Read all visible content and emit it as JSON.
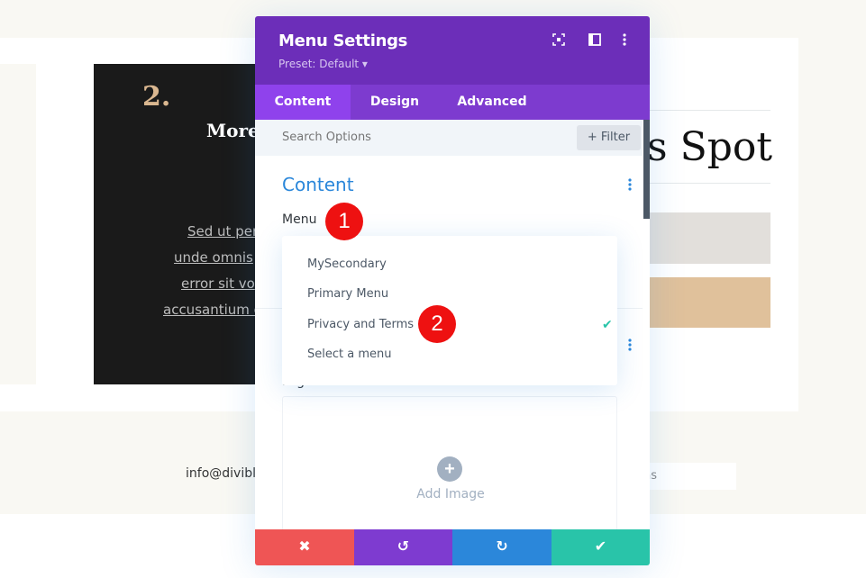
{
  "background": {
    "dark_card": {
      "number": "2.",
      "title": "More",
      "lines": [
        "Sed ut per",
        "unde omnis",
        "error sit vo",
        "accusantium d"
      ]
    },
    "heading_fragment": "s Spot",
    "footer_email": "info@divibl",
    "footer_input_fragment": "ns"
  },
  "modal": {
    "title": "Menu Settings",
    "preset": "Preset: Default ▾",
    "header_icons": [
      "focus-icon",
      "sidebar-toggle-icon",
      "more-options-icon"
    ],
    "tabs": [
      {
        "label": "Content",
        "active": true
      },
      {
        "label": "Design",
        "active": false
      },
      {
        "label": "Advanced",
        "active": false
      }
    ],
    "search": {
      "placeholder": "Search Options"
    },
    "filter_label": "+ Filter",
    "section_title": "Content",
    "menu_label": "Menu",
    "logo_label": "Logo",
    "add_image_label": "Add Image",
    "dropdown": {
      "items": [
        {
          "label": "MySecondary",
          "selected": false
        },
        {
          "label": "Primary Menu",
          "selected": false
        },
        {
          "label": "Privacy and Terms",
          "selected": true
        },
        {
          "label": "Select a menu",
          "selected": false
        }
      ]
    },
    "footer_buttons": [
      {
        "name": "discard",
        "icon": "✖",
        "color": "#ef5555"
      },
      {
        "name": "undo",
        "icon": "↺",
        "color": "#7e3bd0"
      },
      {
        "name": "redo",
        "icon": "↻",
        "color": "#2b87da"
      },
      {
        "name": "save",
        "icon": "✔",
        "color": "#29c4a9"
      }
    ]
  },
  "annotations": [
    {
      "label": "1"
    },
    {
      "label": "2"
    }
  ],
  "colors": {
    "header": "#6c2eb9",
    "tabs": "#7d3bcf",
    "active_tab": "#8f42ec",
    "accent_blue": "#2b87da",
    "check_green": "#29c4a9",
    "annotation_red": "#ee1111"
  }
}
